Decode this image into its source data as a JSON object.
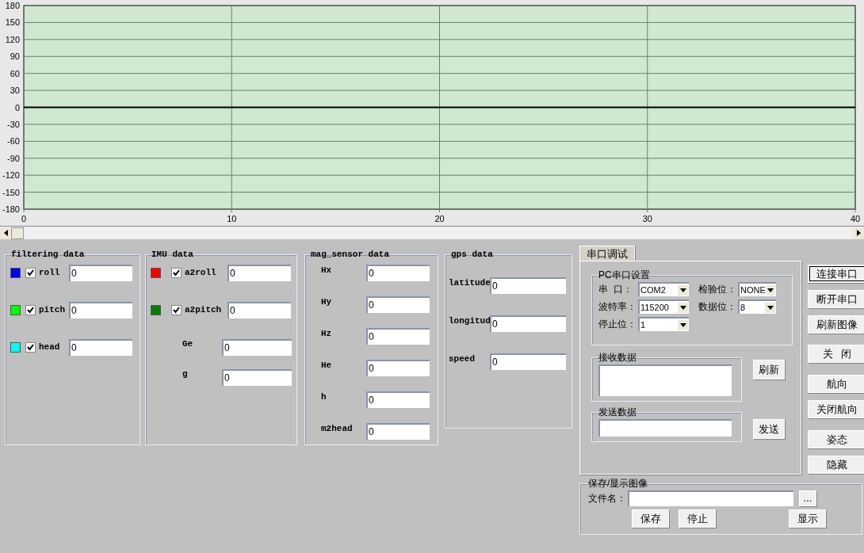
{
  "chart": {
    "chart_data": {
      "type": "line",
      "x": [
        0,
        40
      ],
      "grid": true,
      "xlim": [
        0,
        40
      ],
      "ylim": [
        -180,
        180
      ],
      "xticks": [
        0,
        10,
        20,
        30,
        40
      ],
      "yticks": [
        -180,
        -150,
        -120,
        -90,
        -60,
        -30,
        0,
        30,
        60,
        90,
        120,
        150,
        180
      ],
      "series": [
        {
          "color": "#000000",
          "values": [
            0,
            0
          ]
        }
      ]
    }
  },
  "filtering_data": {
    "title": "filtering data",
    "rows": [
      {
        "color": "#0000ff",
        "checked": true,
        "label": "roll",
        "value": "0"
      },
      {
        "color": "#00ff00",
        "checked": true,
        "label": "pitch",
        "value": "0"
      },
      {
        "color": "#00ffff",
        "checked": true,
        "label": "head",
        "value": "0"
      }
    ]
  },
  "imu_data": {
    "title": "IMU data",
    "rows": [
      {
        "kind": "check",
        "color": "#ff0000",
        "checked": true,
        "label": "a2roll",
        "value": "0"
      },
      {
        "kind": "check",
        "color": "#008000",
        "checked": true,
        "label": "a2pitch",
        "value": "0"
      },
      {
        "kind": "plain",
        "label": "Ge",
        "value": "0"
      },
      {
        "kind": "plain",
        "label": "g",
        "value": "0"
      }
    ]
  },
  "mag_sensor_data": {
    "title": "mag_sensor data",
    "rows": [
      {
        "label": "Hx",
        "value": "0"
      },
      {
        "label": "Hy",
        "value": "0"
      },
      {
        "label": "Hz",
        "value": "0"
      },
      {
        "label": "He",
        "value": "0"
      },
      {
        "label": "h",
        "value": "0"
      },
      {
        "label": "m2head",
        "value": "0"
      }
    ]
  },
  "gps_data": {
    "title": "gps data",
    "rows": [
      {
        "label": "latitude",
        "value": "0"
      },
      {
        "label": "longitud",
        "value": "0"
      },
      {
        "label": "speed",
        "value": "0"
      }
    ]
  },
  "serial_panel": {
    "tabs": [
      {
        "label": "串口调试",
        "selected": true
      }
    ],
    "pc_settings": {
      "title": "PC串口设置",
      "fields": [
        {
          "label": "串  口：",
          "value": "COM2"
        },
        {
          "label": "检验位：",
          "value": "NONE"
        },
        {
          "label": "波特率：",
          "value": "115200"
        },
        {
          "label": "数据位：",
          "value": "8"
        },
        {
          "label": "停止位：",
          "value": "1"
        }
      ]
    },
    "receive": {
      "title": "接收数据",
      "button": "刷新"
    },
    "send": {
      "title": "发送数据",
      "button": "发送"
    }
  },
  "side_buttons": [
    {
      "label": "连接串口",
      "focused": true
    },
    {
      "label": "断开串口",
      "focused": false
    },
    {
      "label": "刷新图像",
      "focused": false
    },
    {
      "label": "关   闭",
      "focused": false
    },
    {
      "label": "航向",
      "focused": false
    },
    {
      "label": "关闭航向",
      "focused": false
    },
    {
      "label": "姿态",
      "focused": false
    },
    {
      "label": "隐藏",
      "focused": false
    }
  ],
  "save_group": {
    "title": "保存/显示图像",
    "file_label": "文件名：",
    "browse": "...",
    "buttons": [
      "保存",
      "停止",
      "显示"
    ]
  }
}
